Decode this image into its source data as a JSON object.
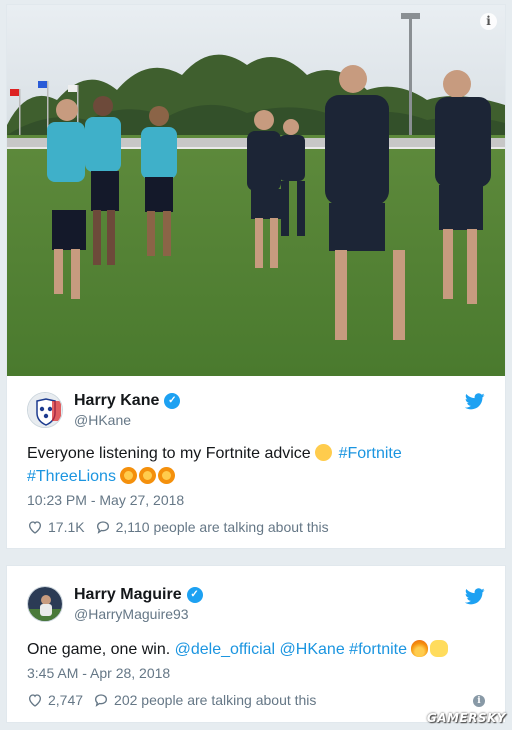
{
  "tweets": [
    {
      "display_name": "Harry Kane",
      "handle": "@HKane",
      "text_parts": {
        "plain": "Everyone listening to my Fortnite advice ",
        "hashtag1": "#Fortnite",
        "hashtag2": "#ThreeLions"
      },
      "timestamp": "10:23 PM - May 27, 2018",
      "likes": "17.1K",
      "talking": "2,110 people are talking about this"
    },
    {
      "display_name": "Harry Maguire",
      "handle": "@HarryMaguire93",
      "text_parts": {
        "plain": "One game, one win. ",
        "mention1": "@dele_official",
        "mention2": "@HKane",
        "hashtag": "#fortnite"
      },
      "timestamp": "3:45 AM - Apr 28, 2018",
      "likes": "2,747",
      "talking": "202 people are talking about this"
    }
  ],
  "icons": {
    "verified": "verified-badge-icon",
    "bird": "twitter-bird-icon",
    "like": "heart-icon",
    "reply": "speech-bubble-icon",
    "info": "info-icon"
  },
  "colors": {
    "link": "#1b95e0",
    "twitter_blue": "#1da1f2",
    "secondary_text": "#657786",
    "background": "#e6ecf0"
  },
  "watermark": "GAMERSKY"
}
